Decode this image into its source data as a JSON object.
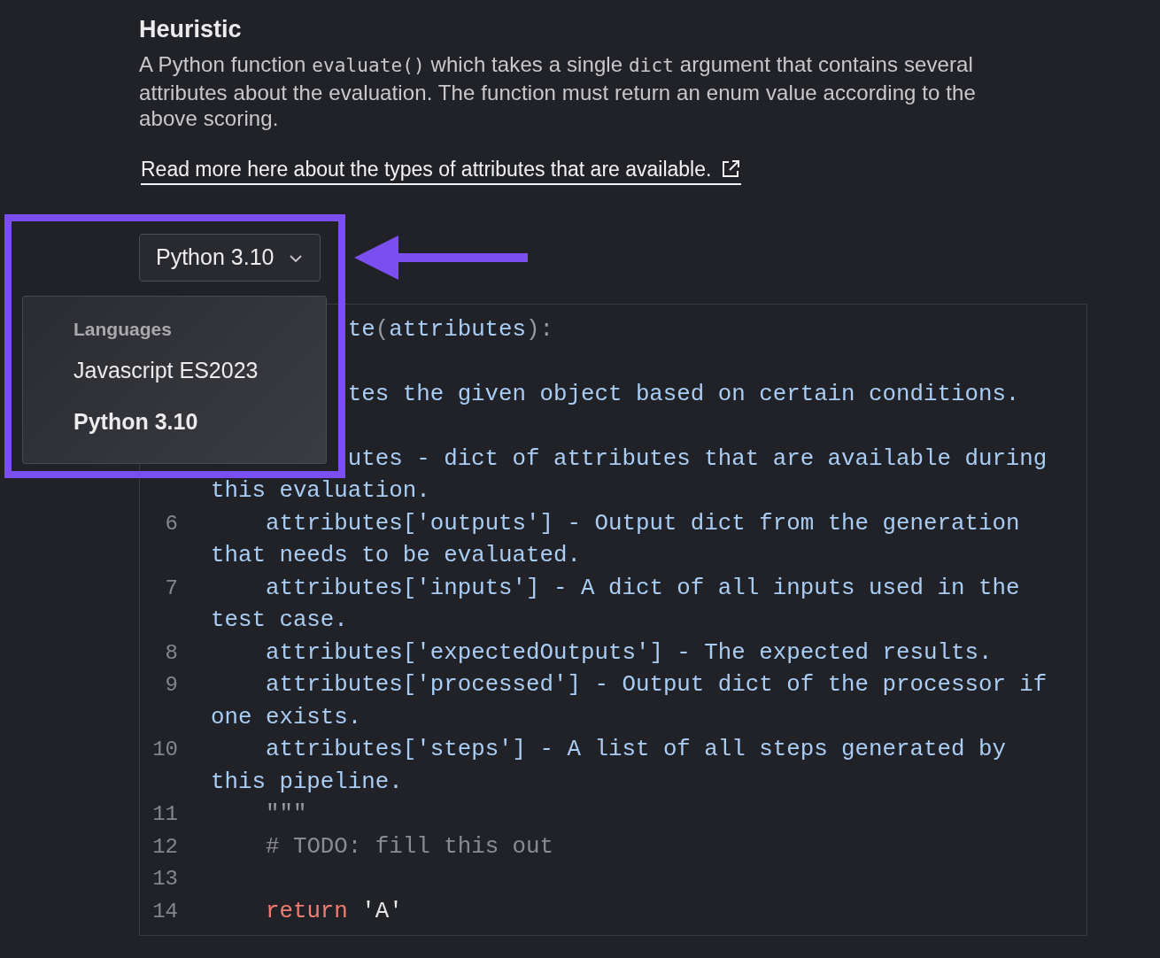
{
  "section": {
    "title": "Heuristic",
    "description": [
      {
        "kind": "text",
        "text": "A Python function "
      },
      {
        "kind": "code",
        "text": "evaluate()"
      },
      {
        "kind": "text",
        "text": " which takes a single "
      },
      {
        "kind": "code",
        "text": "dict"
      },
      {
        "kind": "text",
        "text": " argument that contains several attributes about the evaluation. The function must return an enum value according to the above scoring."
      }
    ],
    "link": "Read more here about the types of attributes that are available."
  },
  "language_select": {
    "value": "Python 3.10",
    "expanded": true
  },
  "language_menu": {
    "header": "Languages",
    "items": [
      {
        "label": "Javascript ES2023",
        "selected": false
      },
      {
        "label": "Python 3.10",
        "selected": true
      }
    ]
  },
  "highlight": {
    "shown": true
  },
  "code": {
    "lines": [
      {
        "kind": "covered",
        "tokens": [
          {
            "kind": "plain",
            "text": "te"
          },
          {
            "kind": "punct",
            "text": "("
          },
          {
            "kind": "plain",
            "text": "attributes"
          },
          {
            "kind": "punct",
            "text": "):"
          }
        ]
      },
      {
        "kind": "covered"
      },
      {
        "kind": "covered",
        "tokens": [
          {
            "kind": "plain",
            "text": "tes the given object based on certain conditions."
          }
        ]
      },
      {
        "kind": "covered"
      },
      {
        "kind": "covered",
        "tokens": [
          {
            "kind": "plain",
            "text": "utes - dict of attributes that are available during this evaluation."
          }
        ]
      },
      {
        "kind": "line",
        "number": "6",
        "tokens": [
          {
            "kind": "plain",
            "text": "    attributes['outputs'] - Output dict from the generation that needs to be evaluated."
          }
        ]
      },
      {
        "kind": "line",
        "number": "7",
        "tokens": [
          {
            "kind": "plain",
            "text": "    attributes['inputs'] - A dict of all inputs used in the test case."
          }
        ]
      },
      {
        "kind": "line",
        "number": "8",
        "tokens": [
          {
            "kind": "plain",
            "text": "    attributes['expectedOutputs'] - The expected results."
          }
        ]
      },
      {
        "kind": "line",
        "number": "9",
        "tokens": [
          {
            "kind": "plain",
            "text": "    attributes['processed'] - Output dict of the processor if one exists."
          }
        ]
      },
      {
        "kind": "line",
        "number": "10",
        "tokens": [
          {
            "kind": "plain",
            "text": "    attributes['steps'] - A list of all steps generated by this pipeline."
          }
        ]
      },
      {
        "kind": "line",
        "number": "11",
        "tokens": [
          {
            "kind": "punct",
            "text": "    \"\"\""
          }
        ]
      },
      {
        "kind": "line",
        "number": "12",
        "tokens": [
          {
            "kind": "comment",
            "text": "    # TODO: fill this out"
          }
        ]
      },
      {
        "kind": "line",
        "number": "13"
      },
      {
        "kind": "line",
        "number": "14",
        "tokens": [
          {
            "kind": "keyword",
            "text": "    return"
          },
          {
            "kind": "string",
            "text": " 'A'"
          }
        ]
      }
    ]
  }
}
